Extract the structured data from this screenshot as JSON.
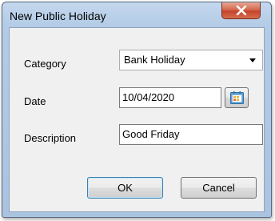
{
  "window": {
    "title": "New Public Holiday"
  },
  "form": {
    "category_label": "Category",
    "category_value": "Bank Holiday",
    "date_label": "Date",
    "date_value": "10/04/2020",
    "description_label": "Description",
    "description_value": "Good Friday"
  },
  "buttons": {
    "ok": "OK",
    "cancel": "Cancel"
  },
  "icons": {
    "close": "close-icon",
    "calendar": "calendar-icon",
    "dropdown": "chevron-down-icon"
  }
}
